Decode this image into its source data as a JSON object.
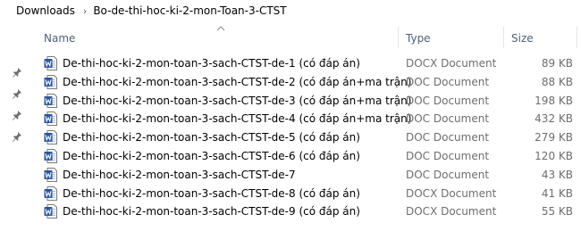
{
  "breadcrumb": {
    "root": "Downloads",
    "current": "Bo-de-thi-hoc-ki-2-mon-Toan-3-CTST"
  },
  "columns": {
    "name": "Name",
    "type": "Type",
    "size": "Size"
  },
  "files": [
    {
      "name": "De-thi-hoc-ki-2-mon-toan-3-sach-CTST-de-1 (có đáp án)",
      "type": "DOCX Document",
      "size": "89 KB",
      "icon": "word-docx-icon"
    },
    {
      "name": "De-thi-hoc-ki-2-mon-toan-3-sach-CTST-de-2 (có đáp án+ma trận)",
      "type": "DOC Document",
      "size": "88 KB",
      "icon": "word-doc-icon"
    },
    {
      "name": "De-thi-hoc-ki-2-mon-toan-3-sach-CTST-de-3 (có đáp án+ma trận)",
      "type": "DOC Document",
      "size": "198 KB",
      "icon": "word-doc-icon"
    },
    {
      "name": "De-thi-hoc-ki-2-mon-toan-3-sach-CTST-de-4 (có đáp án+ma trận)",
      "type": "DOC Document",
      "size": "432 KB",
      "icon": "word-doc-icon"
    },
    {
      "name": "De-thi-hoc-ki-2-mon-toan-3-sach-CTST-de-5 (có đáp án)",
      "type": "DOC Document",
      "size": "279 KB",
      "icon": "word-doc-icon"
    },
    {
      "name": "De-thi-hoc-ki-2-mon-toan-3-sach-CTST-de-6 (có đáp án)",
      "type": "DOC Document",
      "size": "120 KB",
      "icon": "word-doc-icon"
    },
    {
      "name": "De-thi-hoc-ki-2-mon-toan-3-sach-CTST-de-7",
      "type": "DOC Document",
      "size": "43 KB",
      "icon": "word-doc-icon"
    },
    {
      "name": "De-thi-hoc-ki-2-mon-toan-3-sach-CTST-de-8 (có đáp án)",
      "type": "DOCX Document",
      "size": "41 KB",
      "icon": "word-docx-icon"
    },
    {
      "name": "De-thi-hoc-ki-2-mon-toan-3-sach-CTST-de-9 (có đáp án)",
      "type": "DOCX Document",
      "size": "55 KB",
      "icon": "word-docx-icon"
    }
  ],
  "colors": {
    "word_blue": "#2b579a",
    "header_text": "#4c607a",
    "secondary_text": "#6d6d6d",
    "pin": "#6e6e6e"
  }
}
